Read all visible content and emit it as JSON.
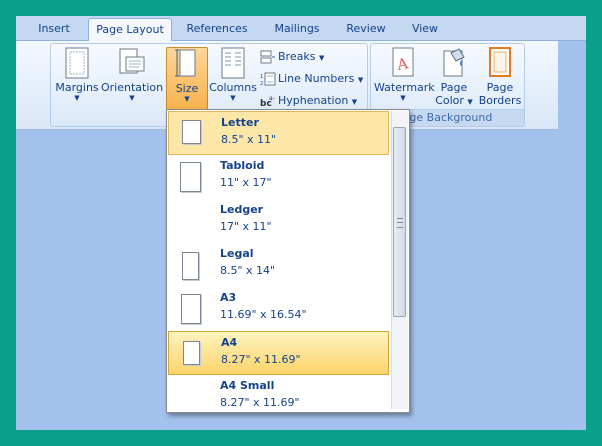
{
  "tabs": [
    {
      "label": "Insert",
      "active": false
    },
    {
      "label": "Page Layout",
      "active": true
    },
    {
      "label": "References",
      "active": false
    },
    {
      "label": "Mailings",
      "active": false
    },
    {
      "label": "Review",
      "active": false
    },
    {
      "label": "View",
      "active": false
    }
  ],
  "page_setup": {
    "margins": "Margins",
    "orientation": "Orientation",
    "size": "Size",
    "columns": "Columns",
    "breaks": "Breaks",
    "line_numbers": "Line Numbers",
    "hyphenation": "Hyphenation"
  },
  "page_background": {
    "watermark": "Watermark",
    "page_color_1": "Page",
    "page_color_2": "Color",
    "page_borders_1": "Page",
    "page_borders_2": "Borders",
    "group_label": "age Background"
  },
  "size_menu": [
    {
      "name": "Letter",
      "dims": "8.5\" x 11\""
    },
    {
      "name": "Tabloid",
      "dims": "11\" x 17\""
    },
    {
      "name": "Ledger",
      "dims": "17\" x 11\""
    },
    {
      "name": "Legal",
      "dims": "8.5\" x 14\""
    },
    {
      "name": "A3",
      "dims": "11.69\" x 16.54\""
    },
    {
      "name": "A4",
      "dims": "8.27\" x 11.69\""
    },
    {
      "name": "A4 Small",
      "dims": "8.27\" x 11.69\""
    }
  ],
  "colors": {
    "frame": "#0aa08c",
    "background": "#a3c1ec",
    "ribbon_text": "#15428b",
    "highlight": "#fbd46a"
  }
}
